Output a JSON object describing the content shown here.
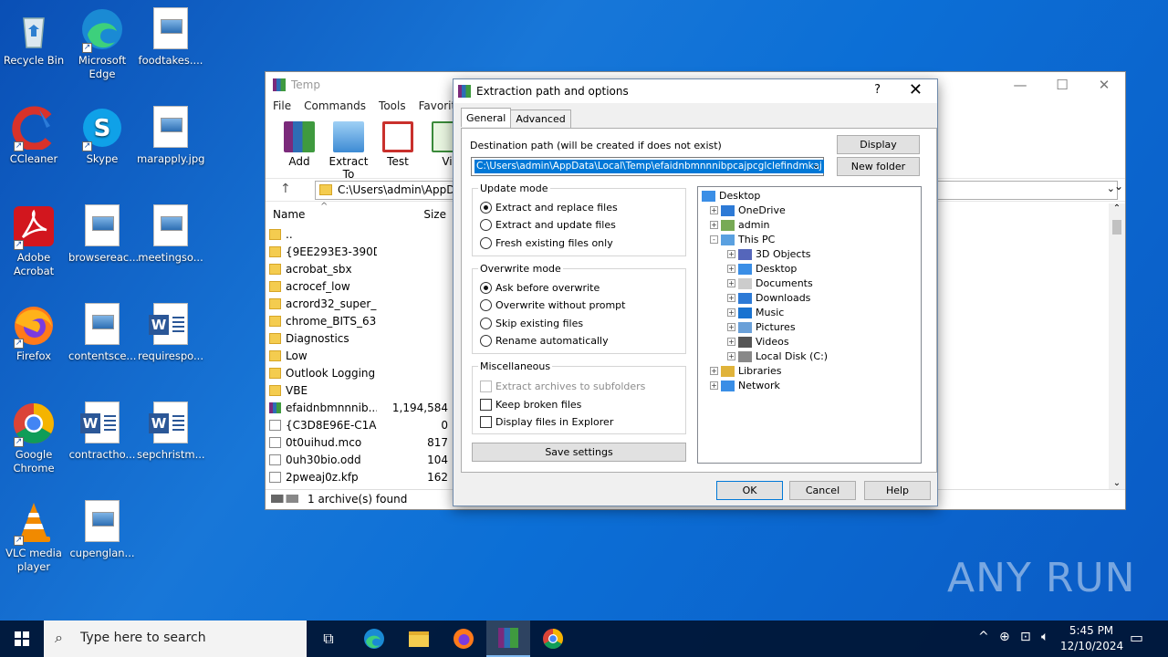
{
  "desktop": {
    "icons": [
      {
        "label": "Recycle Bin"
      },
      {
        "label": "Microsoft Edge"
      },
      {
        "label": "foodtakes...."
      },
      {
        "label": "CCleaner"
      },
      {
        "label": "Skype"
      },
      {
        "label": "marapply.jpg"
      },
      {
        "label": "Adobe Acrobat"
      },
      {
        "label": "browsereac..."
      },
      {
        "label": "meetingso..."
      },
      {
        "label": "Firefox"
      },
      {
        "label": "contentsce..."
      },
      {
        "label": "requirespo..."
      },
      {
        "label": "Google Chrome"
      },
      {
        "label": "contractho..."
      },
      {
        "label": "sepchristm..."
      },
      {
        "label": "VLC media player"
      },
      {
        "label": "cupenglan..."
      }
    ]
  },
  "explorer": {
    "title": "Temp",
    "menu": [
      "File",
      "Commands",
      "Tools",
      "Favorites"
    ],
    "toolbar": [
      "Add",
      "Extract To",
      "Test",
      "Vi"
    ],
    "path": "C:\\Users\\admin\\AppData",
    "col_name": "Name",
    "col_size": "Size",
    "files": [
      {
        "name": "..",
        "size": "",
        "type": "folder"
      },
      {
        "name": "{9EE293E3-390D...",
        "size": "",
        "type": "folder"
      },
      {
        "name": "acrobat_sbx",
        "size": "",
        "type": "folder"
      },
      {
        "name": "acrocef_low",
        "size": "",
        "type": "folder"
      },
      {
        "name": "acrord32_super_...",
        "size": "",
        "type": "folder"
      },
      {
        "name": "chrome_BITS_63...",
        "size": "",
        "type": "folder"
      },
      {
        "name": "Diagnostics",
        "size": "",
        "type": "folder"
      },
      {
        "name": "Low",
        "size": "",
        "type": "folder"
      },
      {
        "name": "Outlook Logging",
        "size": "",
        "type": "folder"
      },
      {
        "name": "VBE",
        "size": "",
        "type": "folder"
      },
      {
        "name": "efaidnbmnnnib...",
        "size": "1,194,584",
        "type": "rar"
      },
      {
        "name": "{C3D8E96E-C1A...",
        "size": "0",
        "type": "doc"
      },
      {
        "name": "0t0uihud.mco",
        "size": "817",
        "type": "doc"
      },
      {
        "name": "0uh30bio.odd",
        "size": "104",
        "type": "doc"
      },
      {
        "name": "2pweaj0z.kfp",
        "size": "162",
        "type": "doc"
      }
    ],
    "status": "1 archive(s) found"
  },
  "dialog": {
    "title": "Extraction path and options",
    "help": "?",
    "close": "✕",
    "tabs": [
      "General",
      "Advanced"
    ],
    "dest_label": "Destination path (will be created if does not exist)",
    "dest_value": "C:\\Users\\admin\\AppData\\Local\\Temp\\efaidnbmnnnibpcajpcglclefindmkaj",
    "display_btn": "Display",
    "newfolder_btn": "New folder",
    "update_title": "Update mode",
    "update_opts": [
      "Extract and replace files",
      "Extract and update files",
      "Fresh existing files only"
    ],
    "overwrite_title": "Overwrite mode",
    "overwrite_opts": [
      "Ask before overwrite",
      "Overwrite without prompt",
      "Skip existing files",
      "Rename automatically"
    ],
    "misc_title": "Miscellaneous",
    "misc_opts": [
      "Extract archives to subfolders",
      "Keep broken files",
      "Display files in Explorer"
    ],
    "save_btn": "Save settings",
    "tree": [
      "Desktop",
      "OneDrive",
      "admin",
      "This PC",
      "3D Objects",
      "Desktop",
      "Documents",
      "Downloads",
      "Music",
      "Pictures",
      "Videos",
      "Local Disk (C:)",
      "Libraries",
      "Network"
    ],
    "ok": "OK",
    "cancel": "Cancel",
    "helpbtn": "Help"
  },
  "taskbar": {
    "search_placeholder": "Type here to search",
    "time": "5:45 PM",
    "date": "12/10/2024"
  },
  "watermark": "ANY RUN"
}
